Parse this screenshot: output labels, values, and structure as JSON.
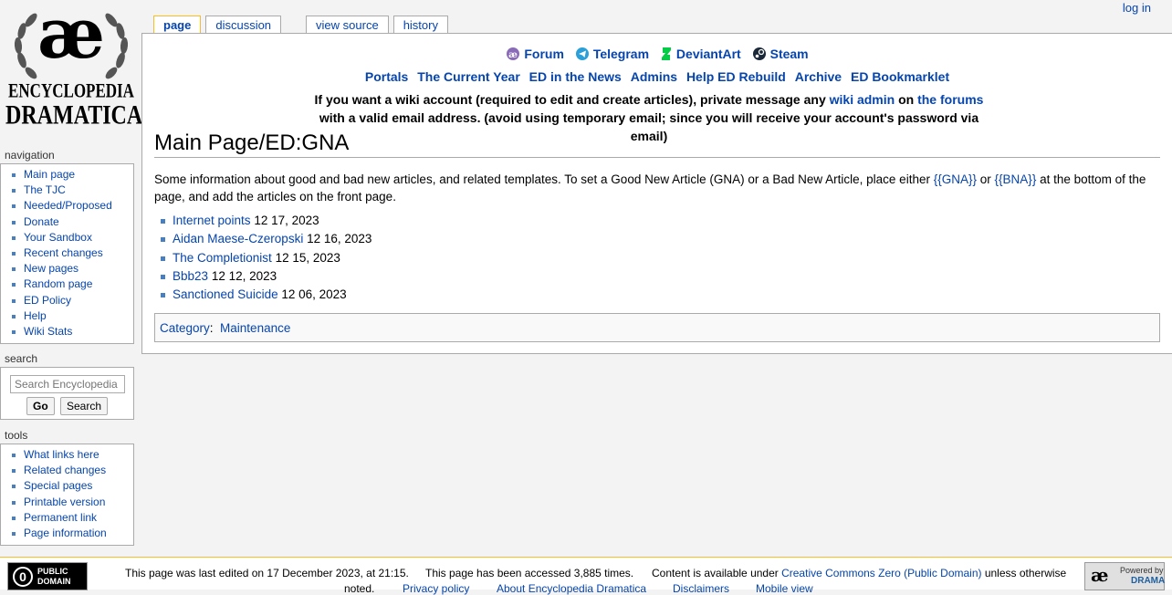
{
  "logo": {
    "mark": "æ",
    "line1": "ENCYCLOPEDIA",
    "line2": "DRAMATICA"
  },
  "tabs": {
    "page": "page",
    "discussion": "discussion",
    "view_source": "view source",
    "history": "history"
  },
  "personal": {
    "login": "log in"
  },
  "header": {
    "icon_links": [
      "Forum",
      "Telegram",
      "DeviantArt",
      "Steam"
    ],
    "links": [
      "Portals",
      "The Current Year",
      "ED in the News",
      "Admins",
      "Help ED Rebuild",
      "Archive",
      "ED Bookmarklet"
    ],
    "notice": {
      "part1": "If you want a wiki account (required to edit and create articles), private message any ",
      "link1": "wiki admin",
      "part2": " on ",
      "link2": "the forums",
      "part3": " with a valid email address. (avoid using temporary email; since you will receive your account's password via email)"
    }
  },
  "page": {
    "title": "Main Page/ED:GNA",
    "intro": {
      "part1": "Some information about good and bad new articles, and related templates. To set a Good New Article (GNA) or a Bad New Article, place either ",
      "gna": "{{GNA}}",
      "or": " or ",
      "bna": "{{BNA}}",
      "part2": " at the bottom of the page, and add the articles on the front page."
    },
    "new_articles": [
      {
        "title": "Internet points",
        "date": "12 17, 2023"
      },
      {
        "title": "Aidan Maese-Czeropski",
        "date": "12 16, 2023"
      },
      {
        "title": "The Completionist",
        "date": "12 15, 2023"
      },
      {
        "title": "Bbb23",
        "date": "12 12, 2023"
      },
      {
        "title": "Sanctioned Suicide",
        "date": "12 06, 2023"
      }
    ],
    "category_label": "Category",
    "category": "Maintenance"
  },
  "sidebar": {
    "navigation": {
      "title": "navigation",
      "items": [
        "Main page",
        "The TJC",
        "Needed/Proposed",
        "Donate",
        "Your Sandbox",
        "Recent changes",
        "New pages",
        "Random page",
        "ED Policy",
        "Help",
        "Wiki Stats"
      ]
    },
    "search": {
      "title": "search",
      "placeholder": "Search Encyclopedia Dramatica",
      "go": "Go",
      "search": "Search"
    },
    "tools": {
      "title": "tools",
      "items": [
        "What links here",
        "Related changes",
        "Special pages",
        "Printable version",
        "Permanent link",
        "Page information"
      ]
    }
  },
  "footer": {
    "pd_badge": {
      "mark": "0",
      "line1": "PUBLIC",
      "line2": "DOMAIN"
    },
    "last_edited": "This page was last edited on 17 December 2023, at 21:15.",
    "accessed": "This page has been accessed 3,885 times.",
    "license_pre": "Content is available under ",
    "license_link": "Creative Commons Zero (Public Domain)",
    "license_post": " unless otherwise",
    "license_wrap": "noted.",
    "links": [
      "Privacy policy",
      "About Encyclopedia Dramatica",
      "Disclaimers",
      "Mobile view"
    ],
    "powered": {
      "mark": "æ",
      "line1": "Powered by",
      "line2": "DRAMA"
    }
  },
  "colors": {
    "link": "#0645ad",
    "tab_selected_border": "#fabd23",
    "bullet": "#4a7fbf"
  }
}
